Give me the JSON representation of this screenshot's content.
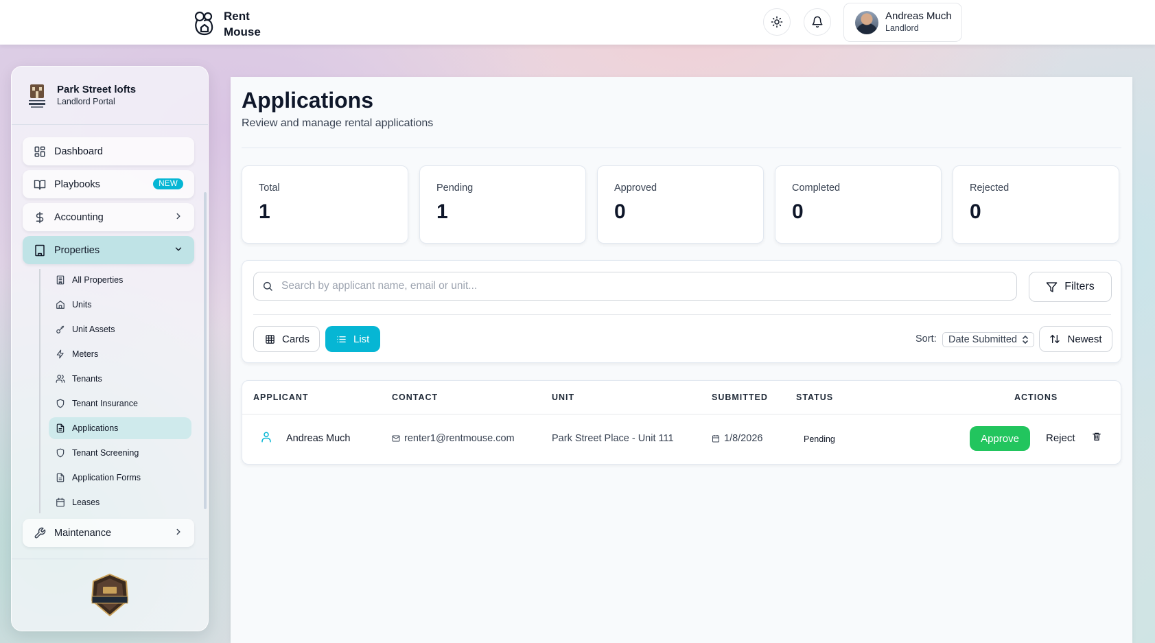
{
  "header": {
    "brand_line1": "Rent",
    "brand_line2": "Mouse",
    "user_name": "Andreas Much",
    "user_role": "Landlord"
  },
  "sidebar": {
    "org_name": "Park Street lofts",
    "org_sub": "Landlord Portal",
    "items": [
      {
        "label": "Dashboard",
        "icon": "dashboard-icon"
      },
      {
        "label": "Playbooks",
        "icon": "book-icon",
        "badge": "NEW"
      },
      {
        "label": "Accounting",
        "icon": "dollar-icon"
      },
      {
        "label": "Properties",
        "icon": "building-icon"
      },
      {
        "label": "Maintenance",
        "icon": "wrench-icon"
      }
    ],
    "properties_sub": [
      {
        "label": "All Properties",
        "icon": "building-icon"
      },
      {
        "label": "Units",
        "icon": "home-icon"
      },
      {
        "label": "Unit Assets",
        "icon": "key-icon"
      },
      {
        "label": "Meters",
        "icon": "bolt-icon"
      },
      {
        "label": "Tenants",
        "icon": "users-icon"
      },
      {
        "label": "Tenant Insurance",
        "icon": "shield-icon"
      },
      {
        "label": "Applications",
        "icon": "document-icon"
      },
      {
        "label": "Tenant Screening",
        "icon": "shield-icon"
      },
      {
        "label": "Application Forms",
        "icon": "document-icon"
      },
      {
        "label": "Leases",
        "icon": "calendar-icon"
      }
    ]
  },
  "main": {
    "title": "Applications",
    "subtitle": "Review and manage rental applications",
    "stats": [
      {
        "label": "Total",
        "value": "1"
      },
      {
        "label": "Pending",
        "value": "1"
      },
      {
        "label": "Approved",
        "value": "0"
      },
      {
        "label": "Completed",
        "value": "0"
      },
      {
        "label": "Rejected",
        "value": "0"
      }
    ],
    "search_placeholder": "Search by applicant name, email or unit...",
    "filters_label": "Filters",
    "view_cards": "Cards",
    "view_list": "List",
    "sort_label": "Sort:",
    "sort_value": "Date Submitted",
    "order_label": "Newest",
    "columns": [
      "APPLICANT",
      "CONTACT",
      "UNIT",
      "SUBMITTED",
      "STATUS",
      "ACTIONS"
    ],
    "rows": [
      {
        "applicant": "Andreas Much",
        "contact": "renter1@rentmouse.com",
        "unit": "Park Street Place - Unit 111",
        "submitted": "1/8/2026",
        "status": "Pending",
        "approve": "Approve",
        "reject": "Reject"
      }
    ]
  },
  "colors": {
    "accent": "#06b6d4",
    "approve": "#22c55e",
    "active_nav": "#bfe3e6"
  }
}
